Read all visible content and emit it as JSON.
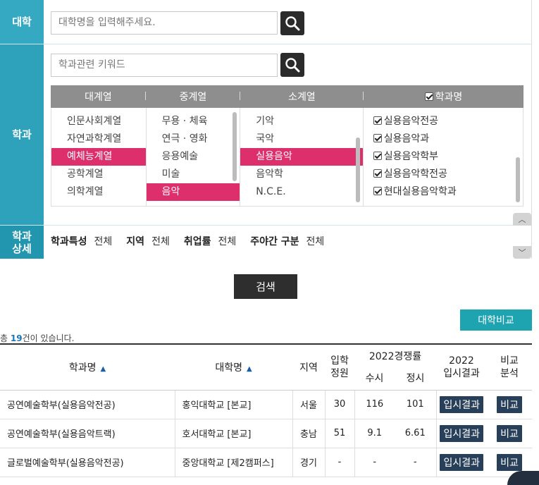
{
  "sections": {
    "univ_label": "대학",
    "dept_label": "학과",
    "detail_label_1": "학과",
    "detail_label_2": "상세"
  },
  "search": {
    "univ_placeholder": "대학명을 입력해주세요.",
    "dept_placeholder": "학과관련 키워드"
  },
  "categories": {
    "headers": [
      "대계열",
      "중계열",
      "소계열",
      "학과명"
    ],
    "major": [
      "인문사회계열",
      "자연과학계열",
      "예체능계열",
      "공학계열",
      "의학계열"
    ],
    "major_selected": 2,
    "middle": [
      "무용 · 체육",
      "연극 · 영화",
      "응용예술",
      "미술",
      "음악"
    ],
    "middle_selected": 4,
    "minor": [
      "기악",
      "국악",
      "실용음악",
      "음악학",
      "N.C.E."
    ],
    "minor_selected": 2,
    "depts": [
      "실용음악전공",
      "실용음악과",
      "실용음악학부",
      "실용음악학전공",
      "현대실용음악학과"
    ]
  },
  "detail": {
    "items": [
      {
        "label": "학과특성",
        "value": "전체"
      },
      {
        "label": "지역",
        "value": "전체"
      },
      {
        "label": "취업률",
        "value": "전체"
      },
      {
        "label": "주야간 구분",
        "value": "전체"
      }
    ]
  },
  "buttons": {
    "search": "검색",
    "compare": "대학비교"
  },
  "result_count": {
    "prefix": "총 ",
    "n": "19",
    "suffix": "건이 있습니다."
  },
  "table": {
    "headers": {
      "dept": "학과명",
      "univ": "대학명",
      "region": "지역",
      "quota_1": "입학",
      "quota_2": "정원",
      "rate": "2022경쟁률",
      "early": "수시",
      "regular": "정시",
      "result_1": "2022",
      "result_2": "입시결과",
      "cmp_1": "비교",
      "cmp_2": "분석"
    },
    "rows": [
      {
        "dept": "공연예술학부(실용음악전공)",
        "univ": "홍익대학교 [본교]",
        "region": "서울",
        "quota": "30",
        "early": "116",
        "regular": "101",
        "result": "입시결과",
        "cmp": "비교"
      },
      {
        "dept": "공연예술학부(실용음악트랙)",
        "univ": "호서대학교 [본교]",
        "region": "충남",
        "quota": "51",
        "early": "9.1",
        "regular": "6.61",
        "result": "입시결과",
        "cmp": "비교"
      },
      {
        "dept": "글로벌예술학부(실용음악전공)",
        "univ": "중앙대학교 [제2캠퍼스]",
        "region": "경기",
        "quota": "-",
        "early": "-",
        "regular": "-",
        "result": "입시결과",
        "cmp": "비교"
      }
    ]
  }
}
